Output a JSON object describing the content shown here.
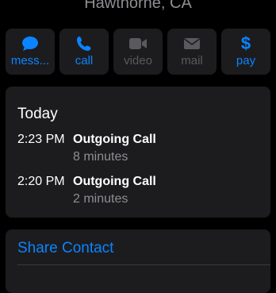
{
  "header": {
    "location": "Hawthorne, CA"
  },
  "actions": [
    {
      "label": "mess...",
      "icon": "message-icon",
      "enabled": true
    },
    {
      "label": "call",
      "icon": "phone-icon",
      "enabled": true
    },
    {
      "label": "video",
      "icon": "video-icon",
      "enabled": false
    },
    {
      "label": "mail",
      "icon": "mail-icon",
      "enabled": false
    },
    {
      "label": "pay",
      "icon": "dollar-icon",
      "enabled": true,
      "glyph": "$"
    }
  ],
  "history": {
    "heading": "Today",
    "calls": [
      {
        "time": "2:23 PM",
        "type": "Outgoing Call",
        "duration": "8 minutes"
      },
      {
        "time": "2:20 PM",
        "type": "Outgoing Call",
        "duration": "2 minutes"
      }
    ]
  },
  "share": {
    "label": "Share Contact"
  },
  "colors": {
    "accent": "#0a84ff",
    "background": "#000000",
    "card": "#1c1c1e",
    "secondary_text": "#8e8e93",
    "disabled": "#5a5a5e"
  }
}
